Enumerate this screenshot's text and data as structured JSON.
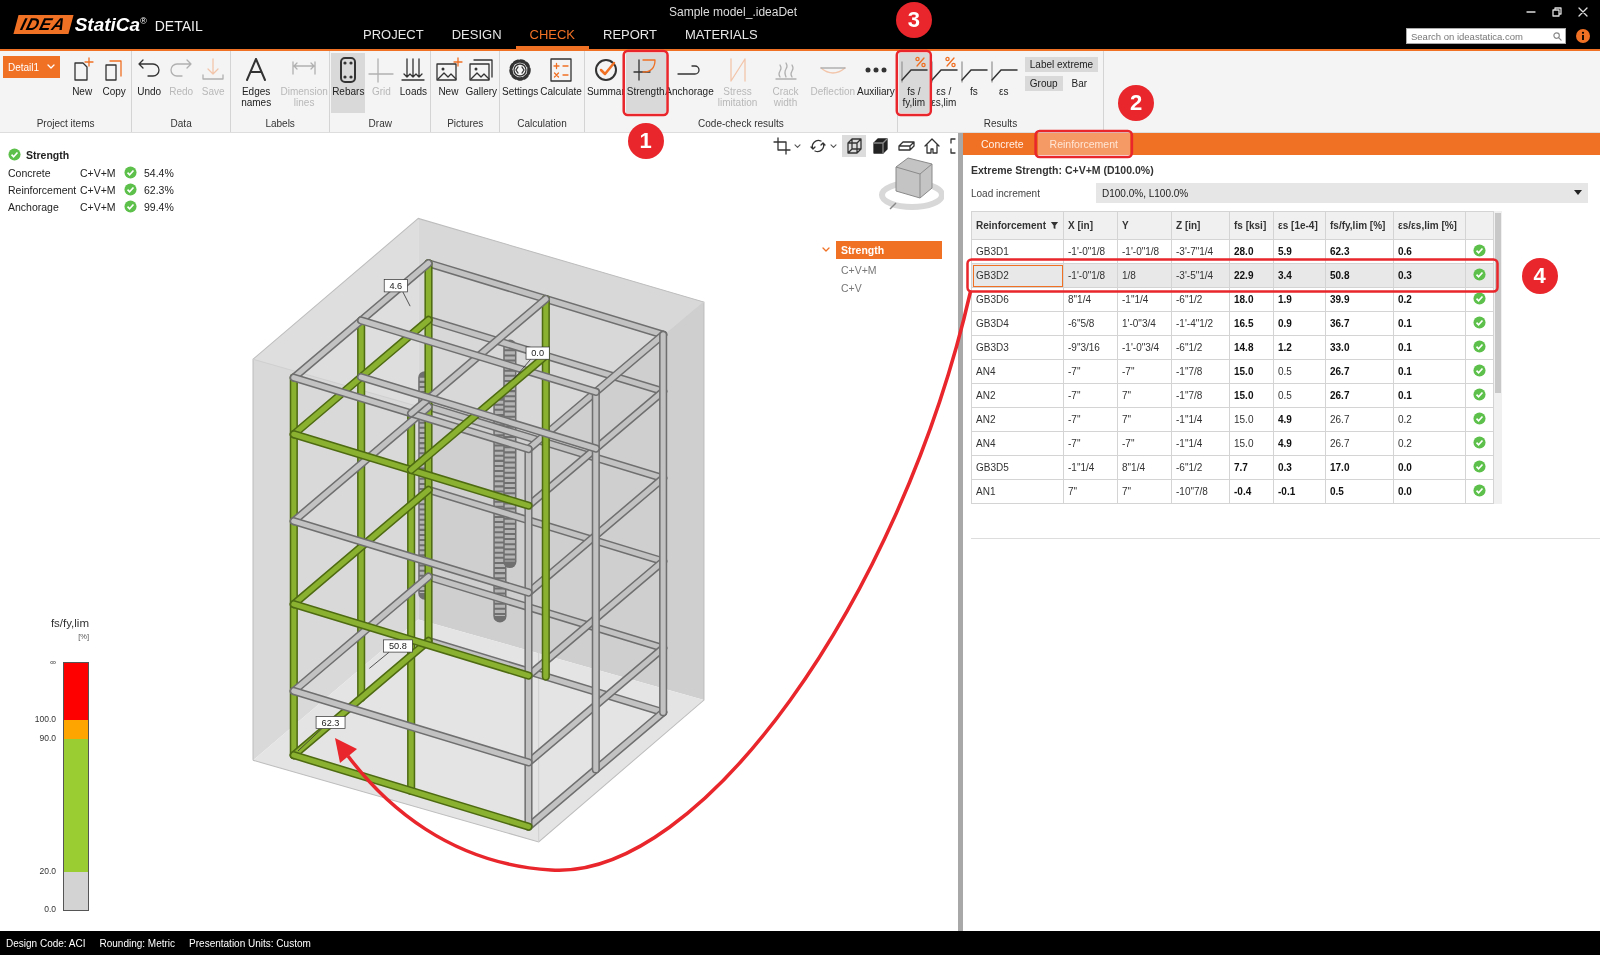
{
  "window": {
    "title": "Sample model_.ideaDet"
  },
  "logo": {
    "mark": "IDEA",
    "name": "StatiCa",
    "registered": "®",
    "product": "DETAIL"
  },
  "menu": [
    {
      "label": "PROJECT",
      "selected": false
    },
    {
      "label": "DESIGN",
      "selected": false
    },
    {
      "label": "CHECK",
      "selected": true
    },
    {
      "label": "REPORT",
      "selected": false
    },
    {
      "label": "MATERIALS",
      "selected": false
    }
  ],
  "search": {
    "placeholder": "Search on ideastatica.com"
  },
  "ribbon": {
    "groups": [
      {
        "label": "Project items",
        "items": [
          {
            "kind": "dropdown",
            "label": "Detail1",
            "disabled": false,
            "selected": false
          },
          {
            "kind": "new",
            "label": "New",
            "disabled": false,
            "selected": false
          },
          {
            "kind": "copy",
            "label": "Copy",
            "disabled": false,
            "selected": false
          }
        ]
      },
      {
        "label": "Data",
        "items": [
          {
            "kind": "undo",
            "label": "Undo",
            "disabled": false,
            "selected": false
          },
          {
            "kind": "redo",
            "label": "Redo",
            "disabled": true,
            "selected": false
          },
          {
            "kind": "save",
            "label": "Save",
            "disabled": true,
            "selected": false
          }
        ]
      },
      {
        "label": "Labels",
        "items": [
          {
            "kind": "edges",
            "label": "Edges names",
            "disabled": false,
            "selected": false
          },
          {
            "kind": "dimension",
            "label": "Dimension lines",
            "disabled": true,
            "selected": false
          }
        ]
      },
      {
        "label": "Draw",
        "items": [
          {
            "kind": "rebars",
            "label": "Rebars",
            "disabled": false,
            "selected": true
          },
          {
            "kind": "grid",
            "label": "Grid",
            "disabled": true,
            "selected": false
          },
          {
            "kind": "loads",
            "label": "Loads",
            "disabled": false,
            "selected": false
          }
        ]
      },
      {
        "label": "Pictures",
        "items": [
          {
            "kind": "picture",
            "label": "New",
            "disabled": false,
            "selected": false
          },
          {
            "kind": "gallery",
            "label": "Gallery",
            "disabled": false,
            "selected": false
          }
        ]
      },
      {
        "label": "Calculation",
        "items": [
          {
            "kind": "settings",
            "label": "Settings",
            "disabled": false,
            "selected": false
          },
          {
            "kind": "calculate",
            "label": "Calculate",
            "disabled": false,
            "selected": false
          }
        ]
      },
      {
        "label": "Code-check results",
        "items": [
          {
            "kind": "summary",
            "label": "Summar",
            "disabled": false,
            "selected": false
          },
          {
            "kind": "strength",
            "label": "Strength",
            "disabled": false,
            "selected": true
          },
          {
            "kind": "anchorage",
            "label": "Anchorage",
            "disabled": false,
            "selected": false
          },
          {
            "kind": "stress",
            "label": "Stress limitation",
            "disabled": true,
            "selected": false
          },
          {
            "kind": "crack",
            "label": "Crack width",
            "disabled": true,
            "selected": false
          },
          {
            "kind": "deflection",
            "label": "Deflection",
            "disabled": true,
            "selected": false
          },
          {
            "kind": "auxiliary",
            "label": "Auxiliary",
            "disabled": false,
            "selected": false
          }
        ]
      },
      {
        "label": "Results",
        "items": [
          {
            "kind": "curve_pct",
            "label": "fs / fy,lim",
            "disabled": false,
            "selected": true
          },
          {
            "kind": "curve_pct",
            "label": "εs / εs,lim",
            "disabled": false,
            "selected": false
          },
          {
            "kind": "curve",
            "label": "fs",
            "disabled": false,
            "selected": false
          },
          {
            "kind": "curve",
            "label": "εs",
            "disabled": false,
            "selected": false
          }
        ],
        "options": [
          {
            "label": "Label extreme",
            "selected": true
          },
          {
            "label": "Group",
            "selected": true
          },
          {
            "label": "Bar",
            "selected": false
          }
        ]
      }
    ]
  },
  "viewport": {
    "summary": {
      "title": "Strength",
      "ok": true,
      "rows": [
        {
          "name": "Concrete",
          "combination": "C+V+M",
          "ok": true,
          "value": "54.4%"
        },
        {
          "name": "Reinforcement",
          "combination": "C+V+M",
          "ok": true,
          "value": "62.3%"
        },
        {
          "name": "Anchorage",
          "combination": "C+V+M",
          "ok": true,
          "value": "99.4%"
        }
      ]
    },
    "view_tools": [
      {
        "kind": "crop",
        "dropdown": true,
        "selected": false
      },
      {
        "kind": "rotate",
        "dropdown": true,
        "selected": false
      },
      {
        "kind": "wireframe",
        "dropdown": false,
        "selected": true
      },
      {
        "kind": "solid",
        "dropdown": false,
        "selected": false
      },
      {
        "kind": "render",
        "dropdown": false,
        "selected": false
      },
      {
        "kind": "home",
        "dropdown": false,
        "selected": false
      },
      {
        "kind": "fullscreen",
        "dropdown": false,
        "selected": false
      }
    ],
    "tree": [
      {
        "label": "Strength",
        "selected": true,
        "expanded": true,
        "children": [
          {
            "label": "C+V+M",
            "selected": false
          },
          {
            "label": "C+V",
            "selected": false
          }
        ]
      }
    ],
    "value_labels": [
      "4.6",
      "0.0",
      "50.8",
      "62.3"
    ],
    "legend": {
      "title": "fs/fy,lim",
      "unit": "[%]",
      "ticks": [
        "∞",
        "100.0",
        "90.0",
        "20.0",
        "0.0"
      ],
      "bands": [
        {
          "color": "#ff0000"
        },
        {
          "color": "#ffa500"
        },
        {
          "color": "#9acd32"
        },
        {
          "color": "#d3d3d3"
        }
      ]
    }
  },
  "results": {
    "tabs": [
      {
        "label": "Concrete",
        "selected": false
      },
      {
        "label": "Reinforcement",
        "selected": true
      }
    ],
    "heading": "Extreme Strength: C+V+M (D100.0%)",
    "load_increment": {
      "label": "Load increment",
      "value": "D100.0%, L100.0%"
    },
    "table": {
      "columns": [
        {
          "label": "Reinforcement",
          "filter": true
        },
        {
          "label": "X [in]",
          "filter": false
        },
        {
          "label": "Y",
          "filter": false
        },
        {
          "label": "Z [in]",
          "filter": false
        },
        {
          "label": "fs [ksi]",
          "filter": false
        },
        {
          "label": "εs [1e-4]",
          "filter": false
        },
        {
          "label": "fs/fy,lim [%]",
          "filter": false
        },
        {
          "label": "εs/εs,lim [%]",
          "filter": false
        }
      ],
      "rows": [
        {
          "cells": [
            "GB3D1",
            "-1'-0\"1/8",
            "-1'-0\"1/8",
            "-3'-7\"1/4",
            "28.0",
            "5.9",
            "62.3",
            "0.6"
          ],
          "extreme": [
            true,
            true,
            true,
            true
          ],
          "ok": true,
          "selected": false
        },
        {
          "cells": [
            "GB3D2",
            "-1'-0\"1/8",
            "1/8",
            "-3'-5\"1/4",
            "22.9",
            "3.4",
            "50.8",
            "0.3"
          ],
          "extreme": [
            true,
            true,
            true,
            true
          ],
          "ok": true,
          "selected": true
        },
        {
          "cells": [
            "GB3D6",
            "8\"1/4",
            "-1\"1/4",
            "-6\"1/2",
            "18.0",
            "1.9",
            "39.9",
            "0.2"
          ],
          "extreme": [
            true,
            true,
            true,
            true
          ],
          "ok": true,
          "selected": false
        },
        {
          "cells": [
            "GB3D4",
            "-6\"5/8",
            "1'-0\"3/4",
            "-1'-4\"1/2",
            "16.5",
            "0.9",
            "36.7",
            "0.1"
          ],
          "extreme": [
            true,
            true,
            true,
            true
          ],
          "ok": true,
          "selected": false
        },
        {
          "cells": [
            "GB3D3",
            "-9\"3/16",
            "-1'-0\"3/4",
            "-6\"1/2",
            "14.8",
            "1.2",
            "33.0",
            "0.1"
          ],
          "extreme": [
            true,
            true,
            true,
            true
          ],
          "ok": true,
          "selected": false
        },
        {
          "cells": [
            "AN4",
            "-7\"",
            "-7\"",
            "-1\"7/8",
            "15.0",
            "0.5",
            "26.7",
            "0.1"
          ],
          "extreme": [
            true,
            false,
            true,
            true
          ],
          "ok": true,
          "selected": false
        },
        {
          "cells": [
            "AN2",
            "-7\"",
            "7\"",
            "-1\"7/8",
            "15.0",
            "0.5",
            "26.7",
            "0.1"
          ],
          "extreme": [
            true,
            false,
            true,
            true
          ],
          "ok": true,
          "selected": false
        },
        {
          "cells": [
            "AN2",
            "-7\"",
            "7\"",
            "-1\"1/4",
            "15.0",
            "4.9",
            "26.7",
            "0.2"
          ],
          "extreme": [
            false,
            true,
            false,
            false
          ],
          "ok": true,
          "selected": false
        },
        {
          "cells": [
            "AN4",
            "-7\"",
            "-7\"",
            "-1\"1/4",
            "15.0",
            "4.9",
            "26.7",
            "0.2"
          ],
          "extreme": [
            false,
            true,
            false,
            false
          ],
          "ok": true,
          "selected": false
        },
        {
          "cells": [
            "GB3D5",
            "-1\"1/4",
            "8\"1/4",
            "-6\"1/2",
            "7.7",
            "0.3",
            "17.0",
            "0.0"
          ],
          "extreme": [
            true,
            true,
            true,
            true
          ],
          "ok": true,
          "selected": false
        },
        {
          "cells": [
            "AN1",
            "7\"",
            "7\"",
            "-10\"7/8",
            "-0.4",
            "-0.1",
            "0.5",
            "0.0"
          ],
          "extreme": [
            true,
            true,
            true,
            true
          ],
          "ok": true,
          "selected": false
        }
      ]
    }
  },
  "status_bar": [
    "Design Code: ACI",
    "Rounding: Metric",
    "Presentation Units: Custom"
  ],
  "annotations": [
    {
      "number": "1"
    },
    {
      "number": "2"
    },
    {
      "number": "3"
    },
    {
      "number": "4"
    }
  ]
}
